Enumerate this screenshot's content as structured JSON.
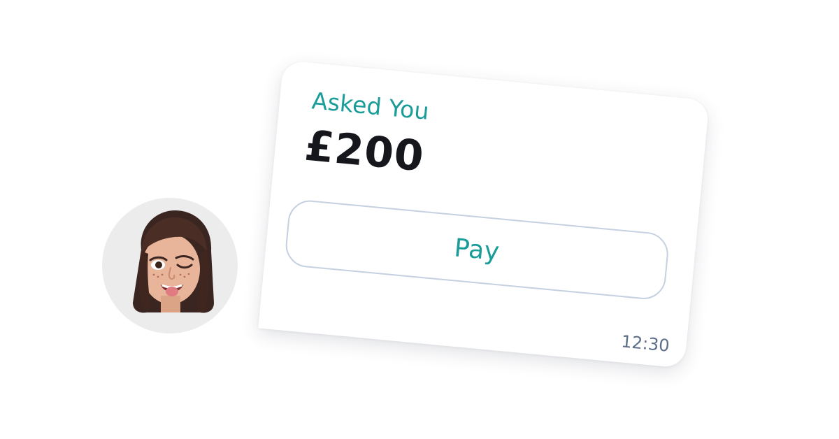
{
  "avatar": {
    "icon": "memoji-avatar-icon",
    "background_color": "#ececec"
  },
  "request_card": {
    "label": "Asked You",
    "amount": "£200",
    "pay_button_label": "Pay",
    "time": "12:30",
    "accent_color": "#1a9c98",
    "amount_color": "#15171c",
    "time_color": "#5d6e88",
    "button_border_color": "#c5d0e0"
  }
}
